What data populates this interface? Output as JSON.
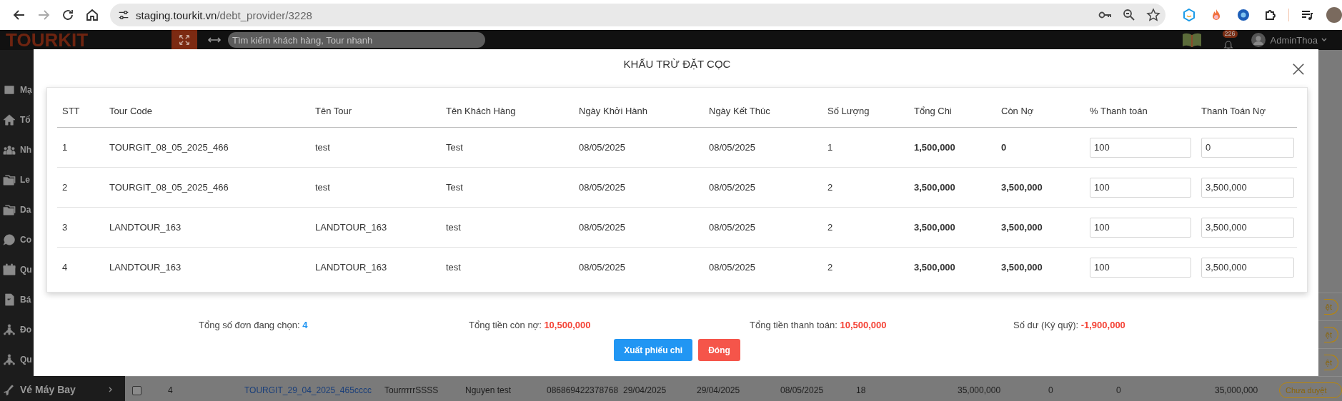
{
  "browser": {
    "url_host": "staging.tourkit.vn",
    "url_path": "/debt_provider/3228",
    "forward_disabled": true
  },
  "header": {
    "logo": "TOURKIT",
    "search": {
      "placeholder": "Tìm kiếm khách hàng, Tour nhanh"
    },
    "notifications": "226",
    "user": "AdminThoa"
  },
  "sidebar": {
    "items": [
      {
        "label": "Mạ"
      },
      {
        "label": "Tổ"
      },
      {
        "label": "Nh"
      },
      {
        "label": "Le"
      },
      {
        "label": "Da"
      },
      {
        "label": "Co"
      },
      {
        "label": "Qu"
      },
      {
        "label": "Bá"
      },
      {
        "label": "Đo"
      },
      {
        "label": "Qu"
      }
    ],
    "bottom_item": {
      "label": "Vé Máy Bay"
    }
  },
  "background_table": {
    "rows": [
      {
        "kind": "partial",
        "status": "ệt"
      },
      {
        "kind": "partial",
        "status": "ệt"
      },
      {
        "kind": "partial",
        "status": "ệt"
      },
      {
        "kind": "full",
        "checked": false,
        "cells": [
          "4",
          "TOURGIT_29_04_2025_465cccc",
          "TourrrrrrSSSS",
          "Nguyen test",
          "086869422378768",
          "29/04/2025",
          "29/04/2025",
          "08/05/2025",
          "18",
          "35,000,000",
          "0",
          "0",
          "35,000,000"
        ],
        "status": "Chưa duyệt"
      }
    ]
  },
  "modal": {
    "title": "KHẤU TRỪ ĐẶT CỌC",
    "columns": [
      "STT",
      "Tour Code",
      "Tên Tour",
      "Tên Khách Hàng",
      "Ngày Khởi Hành",
      "Ngày Kết Thúc",
      "Số Lượng",
      "Tổng Chi",
      "Còn Nợ",
      "% Thanh toán",
      "Thanh Toán Nợ"
    ],
    "rows": [
      {
        "cells": [
          "1",
          "TOURGIT_08_05_2025_466",
          "test",
          "Test",
          "08/05/2025",
          "08/05/2025",
          "1",
          "1,500,000",
          "0"
        ],
        "pay_percent": "100",
        "pay_debt": "0"
      },
      {
        "cells": [
          "2",
          "TOURGIT_08_05_2025_466",
          "test",
          "Test",
          "08/05/2025",
          "08/05/2025",
          "2",
          "3,500,000",
          "3,500,000"
        ],
        "pay_percent": "100",
        "pay_debt": "3,500,000"
      },
      {
        "cells": [
          "3",
          "LANDTOUR_163",
          "LANDTOUR_163",
          "test",
          "08/05/2025",
          "08/05/2025",
          "2",
          "3,500,000",
          "3,500,000"
        ],
        "pay_percent": "100",
        "pay_debt": "3,500,000"
      },
      {
        "cells": [
          "4",
          "LANDTOUR_163",
          "LANDTOUR_163",
          "test",
          "08/05/2025",
          "08/05/2025",
          "2",
          "3,500,000",
          "3,500,000"
        ],
        "pay_percent": "100",
        "pay_debt": "3,500,000"
      }
    ],
    "summary": [
      {
        "label": "Tổng số đơn đang chọn:",
        "value": "4",
        "color": "#2196f3"
      },
      {
        "label": "Tổng tiền còn nợ:",
        "value": "10,500,000",
        "color": "#f44336"
      },
      {
        "label": "Tổng tiền thanh toán:",
        "value": "10,500,000",
        "color": "#f44336"
      },
      {
        "label": "Số dư (Ký quỹ):",
        "value": "-1,900,000",
        "color": "#f44336"
      }
    ],
    "buttons": [
      {
        "label": "Xuất phiếu chi",
        "kind": "primary"
      },
      {
        "label": "Đóng",
        "kind": "danger"
      }
    ]
  }
}
